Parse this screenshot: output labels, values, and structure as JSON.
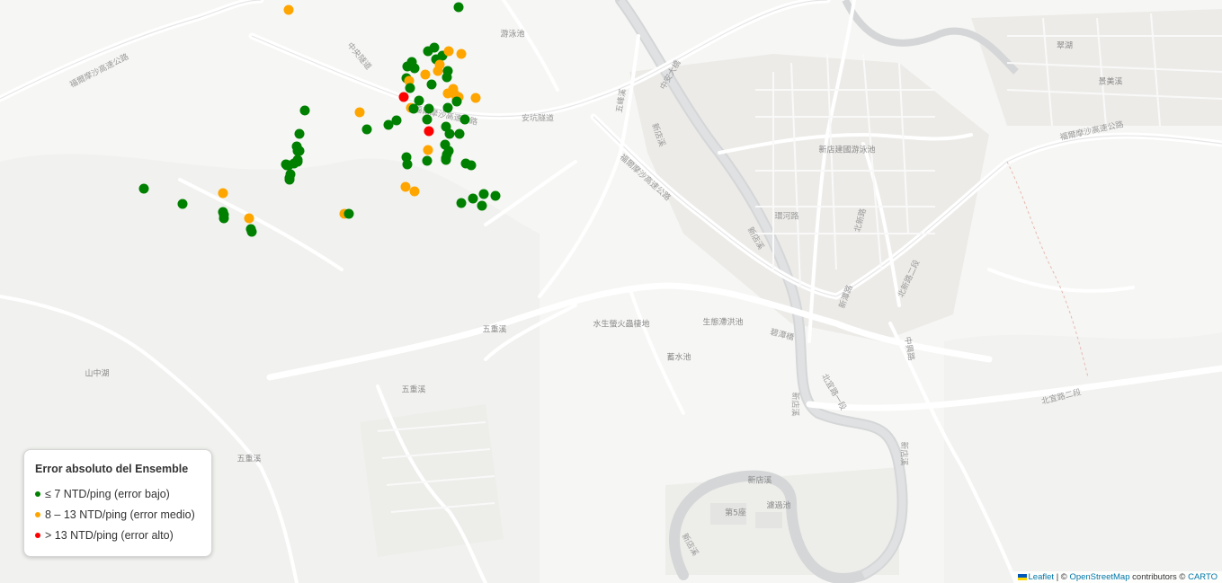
{
  "legend": {
    "title": "Error absoluto del Ensemble",
    "items": [
      {
        "label": "≤ 7 NTD/ping (error bajo)",
        "color": "#008000"
      },
      {
        "label": "8 – 13 NTD/ping (error medio)",
        "color": "#FFA500"
      },
      {
        "label": "> 13 NTD/ping (error alto)",
        "color": "#FF0000"
      }
    ]
  },
  "attribution": {
    "leaflet": "Leaflet",
    "sep": "| ©",
    "osm": "OpenStreetMap",
    "contributors": "contributors ©",
    "carto": "CARTO"
  },
  "place_labels": {
    "l1": "游泳池",
    "l2": "山中湖",
    "l3": "五重溪",
    "l4": "五重溪",
    "l5": "五重溪",
    "l6": "水生螢火蟲棲地",
    "l7": "生態滯洪池",
    "l8": "蓄水池",
    "l9": "新店建國游泳池",
    "l10": "新店溪",
    "l11": "濾過池",
    "l12": "第5座",
    "l13": "翠湖",
    "l14": "景美溪",
    "l15": "安坑隧道",
    "l16": "福爾摩沙高速公路",
    "l17": "福爾摩沙高速公路",
    "l18": "福爾摩沙高速公路",
    "l19": "福爾摩沙高速公路",
    "l20": "新店溪",
    "l21": "新店溪",
    "l22": "新店溪",
    "l23": "新店溪",
    "l24": "北宜路一段",
    "l25": "北宜路二段",
    "l26": "碧潭橋",
    "l27": "中安大橋",
    "l28": "環河路",
    "l29": "北新路",
    "l30": "北新路二段",
    "l31": "中央隧道",
    "l32": "五峰溪",
    "l33": "新店溪",
    "l34": "新潭路",
    "l35": "中興路"
  },
  "markers": [
    {
      "lat": 24.9862,
      "lng": 121.5417,
      "level": "bajo"
    },
    {
      "lat": 24.9859,
      "lng": 121.5228,
      "level": "medio"
    },
    {
      "lat": 24.9796,
      "lng": 121.536,
      "level": "bajo"
    },
    {
      "lat": 24.9801,
      "lng": 121.5365,
      "level": "bajo"
    },
    {
      "lat": 24.9794,
      "lng": 121.5368,
      "level": "bajo"
    },
    {
      "lat": 24.9791,
      "lng": 121.5394,
      "level": "medio"
    },
    {
      "lat": 24.9787,
      "lng": 121.538,
      "level": "medio"
    },
    {
      "lat": 24.9776,
      "lng": 121.5387,
      "level": "bajo"
    },
    {
      "lat": 24.9783,
      "lng": 121.5359,
      "level": "bajo"
    },
    {
      "lat": 24.978,
      "lng": 121.5362,
      "level": "medio"
    },
    {
      "lat": 24.9804,
      "lng": 121.5392,
      "level": "bajo"
    },
    {
      "lat": 24.9808,
      "lng": 121.5399,
      "level": "bajo"
    },
    {
      "lat": 24.9817,
      "lng": 121.539,
      "level": "bajo"
    },
    {
      "lat": 24.9813,
      "lng": 121.5383,
      "level": "bajo"
    },
    {
      "lat": 24.9791,
      "lng": 121.5405,
      "level": "bajo"
    },
    {
      "lat": 24.9784,
      "lng": 121.5404,
      "level": "bajo"
    },
    {
      "lat": 24.9798,
      "lng": 121.5396,
      "level": "medio"
    },
    {
      "lat": 24.981,
      "lng": 121.542,
      "level": "medio"
    },
    {
      "lat": 24.9813,
      "lng": 121.5406,
      "level": "medio"
    },
    {
      "lat": 24.9771,
      "lng": 121.5411,
      "level": "medio"
    },
    {
      "lat": 24.9766,
      "lng": 121.5405,
      "level": "medio"
    },
    {
      "lat": 24.9766,
      "lng": 121.5412,
      "level": "medio"
    },
    {
      "lat": 24.9762,
      "lng": 121.5417,
      "level": "medio"
    },
    {
      "lat": 24.976,
      "lng": 121.5415,
      "level": "medio"
    },
    {
      "lat": 24.9761,
      "lng": 121.5436,
      "level": "medio"
    },
    {
      "lat": 24.9772,
      "lng": 121.5363,
      "level": "bajo"
    },
    {
      "lat": 24.9758,
      "lng": 121.5373,
      "level": "bajo"
    },
    {
      "lat": 24.9762,
      "lng": 121.5356,
      "level": "alto"
    },
    {
      "lat": 24.9757,
      "lng": 121.5415,
      "level": "bajo"
    },
    {
      "lat": 24.975,
      "lng": 121.5405,
      "level": "bajo"
    },
    {
      "lat": 24.9749,
      "lng": 121.5384,
      "level": "bajo"
    },
    {
      "lat": 24.975,
      "lng": 121.5364,
      "level": "medio"
    },
    {
      "lat": 24.9749,
      "lng": 121.5367,
      "level": "bajo"
    },
    {
      "lat": 24.9745,
      "lng": 121.5307,
      "level": "medio"
    },
    {
      "lat": 24.9736,
      "lng": 121.5348,
      "level": "bajo"
    },
    {
      "lat": 24.9731,
      "lng": 121.5339,
      "level": "bajo"
    },
    {
      "lat": 24.9726,
      "lng": 121.5315,
      "level": "bajo"
    },
    {
      "lat": 24.9737,
      "lng": 121.5382,
      "level": "bajo"
    },
    {
      "lat": 24.9729,
      "lng": 121.5403,
      "level": "bajo"
    },
    {
      "lat": 24.9737,
      "lng": 121.5424,
      "level": "bajo"
    },
    {
      "lat": 24.9724,
      "lng": 121.5384,
      "level": "alto"
    },
    {
      "lat": 24.9721,
      "lng": 121.5407,
      "level": "bajo"
    },
    {
      "lat": 24.9721,
      "lng": 121.5418,
      "level": "bajo"
    },
    {
      "lat": 24.9747,
      "lng": 121.5246,
      "level": "bajo"
    },
    {
      "lat": 24.9721,
      "lng": 121.524,
      "level": "bajo"
    },
    {
      "lat": 24.9707,
      "lng": 121.5237,
      "level": "bajo"
    },
    {
      "lat": 24.9702,
      "lng": 121.5238,
      "level": "bajo"
    },
    {
      "lat": 24.9702,
      "lng": 121.524,
      "level": "bajo"
    },
    {
      "lat": 24.9692,
      "lng": 121.5238,
      "level": "bajo"
    },
    {
      "lat": 24.969,
      "lng": 121.5238,
      "level": "bajo"
    },
    {
      "lat": 24.9688,
      "lng": 121.5234,
      "level": "bajo"
    },
    {
      "lat": 24.9687,
      "lng": 121.5225,
      "level": "bajo"
    },
    {
      "lat": 24.9686,
      "lng": 121.5226,
      "level": "bajo"
    },
    {
      "lat": 24.9686,
      "lng": 121.5228,
      "level": "bajo"
    },
    {
      "lat": 24.9676,
      "lng": 121.523,
      "level": "bajo"
    },
    {
      "lat": 24.9672,
      "lng": 121.5229,
      "level": "bajo"
    },
    {
      "lat": 24.967,
      "lng": 121.5229,
      "level": "bajo"
    },
    {
      "lat": 24.9709,
      "lng": 121.5402,
      "level": "bajo"
    },
    {
      "lat": 24.9702,
      "lng": 121.5406,
      "level": "bajo"
    },
    {
      "lat": 24.9703,
      "lng": 121.5383,
      "level": "medio"
    },
    {
      "lat": 24.9698,
      "lng": 121.5404,
      "level": "bajo"
    },
    {
      "lat": 24.9694,
      "lng": 121.5403,
      "level": "bajo"
    },
    {
      "lat": 24.9692,
      "lng": 121.5403,
      "level": "bajo"
    },
    {
      "lat": 24.9695,
      "lng": 121.5359,
      "level": "bajo"
    },
    {
      "lat": 24.9691,
      "lng": 121.5382,
      "level": "bajo"
    },
    {
      "lat": 24.9687,
      "lng": 121.536,
      "level": "bajo"
    },
    {
      "lat": 24.9688,
      "lng": 121.5425,
      "level": "bajo"
    },
    {
      "lat": 24.9686,
      "lng": 121.5431,
      "level": "bajo"
    },
    {
      "lat": 24.9662,
      "lng": 121.5358,
      "level": "medio"
    },
    {
      "lat": 24.9657,
      "lng": 121.5368,
      "level": "medio"
    },
    {
      "lat": 24.9654,
      "lng": 121.5445,
      "level": "bajo"
    },
    {
      "lat": 24.9652,
      "lng": 121.5458,
      "level": "bajo"
    },
    {
      "lat": 24.9649,
      "lng": 121.5433,
      "level": "bajo"
    },
    {
      "lat": 24.9644,
      "lng": 121.542,
      "level": "bajo"
    },
    {
      "lat": 24.9641,
      "lng": 121.5443,
      "level": "bajo"
    },
    {
      "lat": 24.966,
      "lng": 121.5067,
      "level": "bajo"
    },
    {
      "lat": 24.9655,
      "lng": 121.5155,
      "level": "medio"
    },
    {
      "lat": 24.9643,
      "lng": 121.511,
      "level": "bajo"
    },
    {
      "lat": 24.9634,
      "lng": 121.5155,
      "level": "bajo"
    },
    {
      "lat": 24.9631,
      "lng": 121.5156,
      "level": "bajo"
    },
    {
      "lat": 24.9627,
      "lng": 121.5156,
      "level": "bajo"
    },
    {
      "lat": 24.9627,
      "lng": 121.5184,
      "level": "medio"
    },
    {
      "lat": 24.9632,
      "lng": 121.529,
      "level": "medio"
    },
    {
      "lat": 24.9632,
      "lng": 121.5295,
      "level": "bajo"
    },
    {
      "lat": 24.9615,
      "lng": 121.5186,
      "level": "bajo"
    },
    {
      "lat": 24.9612,
      "lng": 121.5187,
      "level": "bajo"
    }
  ]
}
